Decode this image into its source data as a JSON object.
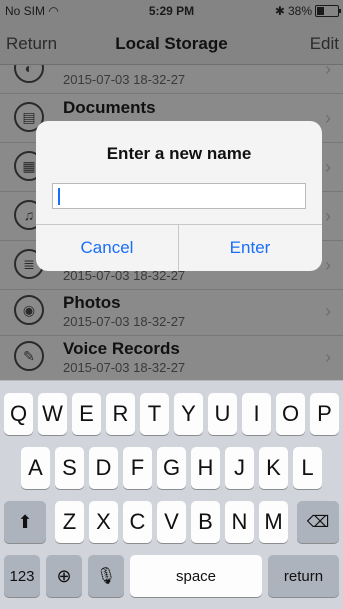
{
  "status_bar": {
    "carrier": "No SIM",
    "time": "5:29 PM",
    "battery": "38%",
    "battery_level": 0.38
  },
  "nav": {
    "back_label": "Return",
    "title": "Local Storage",
    "edit_label": "Edit"
  },
  "list": {
    "rows": [
      {
        "name": "",
        "date": "2015-07-03 18-32-27",
        "icon": "storage-icon"
      },
      {
        "name": "Documents",
        "date": "",
        "icon": "documents-icon"
      },
      {
        "name": "",
        "date": "",
        "icon": "grid-icon"
      },
      {
        "name": "",
        "date": "",
        "icon": "music-icon"
      },
      {
        "name": "",
        "date": "2015-07-03 18-32-27",
        "icon": "list-icon"
      },
      {
        "name": "Photos",
        "date": "2015-07-03 18-32-27",
        "icon": "camera-icon"
      },
      {
        "name": "Voice Records",
        "date": "2015-07-03 18-32-27",
        "icon": "microphone-icon"
      }
    ]
  },
  "dialog": {
    "title": "Enter a new name",
    "input_value": "",
    "cancel_label": "Cancel",
    "enter_label": "Enter"
  },
  "keyboard": {
    "row1": [
      "Q",
      "W",
      "E",
      "R",
      "T",
      "Y",
      "U",
      "I",
      "O",
      "P"
    ],
    "row2": [
      "A",
      "S",
      "D",
      "F",
      "G",
      "H",
      "J",
      "K",
      "L"
    ],
    "row3": [
      "Z",
      "X",
      "C",
      "V",
      "B",
      "N",
      "M"
    ],
    "numbers_label": "123",
    "space_label": "space",
    "return_label": "return"
  },
  "colors": {
    "accent": "#1a6ef7",
    "dim_overlay": "#8e8e8e",
    "keyboard_bg": "#d1d5db"
  }
}
